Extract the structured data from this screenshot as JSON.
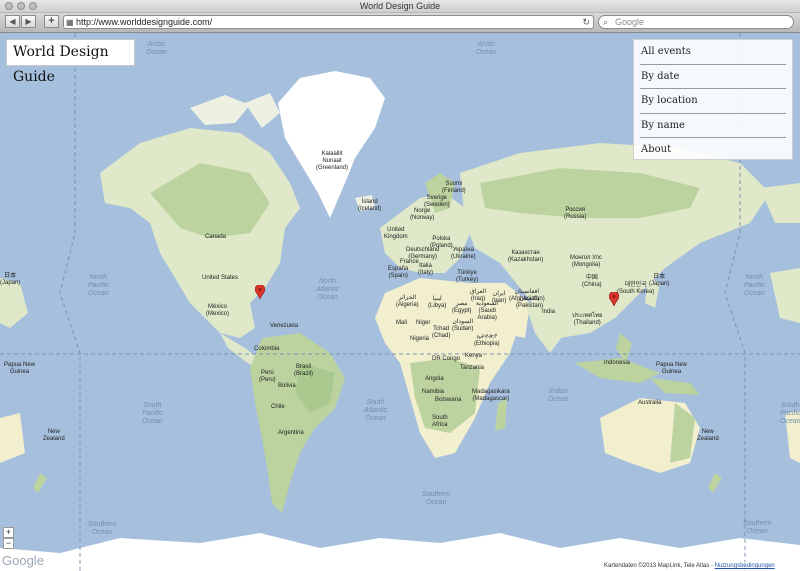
{
  "window": {
    "title": "World Design Guide"
  },
  "toolbar": {
    "back_icon": "chevron-left-icon",
    "forward_icon": "chevron-right-icon",
    "add_label": "+",
    "url": "http://www.worlddesignguide.com/",
    "search_placeholder": "Google"
  },
  "site": {
    "title": "World Design Guide"
  },
  "menu": {
    "items": [
      {
        "label": "All events"
      },
      {
        "label": "By date"
      },
      {
        "label": "By location"
      },
      {
        "label": "By name"
      },
      {
        "label": "About"
      }
    ]
  },
  "map": {
    "zoom_in": "+",
    "zoom_out": "−",
    "logo": "Google",
    "attribution": "Kartendaten ©2013 MapLink, Tele Atlas - ",
    "terms_link": "Nutzungsbedingungen",
    "oceans": {
      "arctic_left": "Arctic\nOcean",
      "arctic_right": "Arctic\nOcean",
      "north_pacific_left": "North\nPacific\nOcean",
      "north_atlantic": "North\nAtlantic\nOcean",
      "north_pacific_right": "North\nPacific\nOcean",
      "south_pacific_left": "South\nPacific\nOcean",
      "south_atlantic": "South\nAtlantic\nOcean",
      "indian": "Indian\nOcean",
      "south_pacific_right": "South\nPacific\nOcean",
      "southern_left": "Southern\nOcean",
      "southern_mid": "Southern\nOcean",
      "southern_right": "Southern\nOcean"
    },
    "labels": {
      "greenland": "Kalaallit\nNunaat\n(Greenland)",
      "iceland": "Ísland\n(Iceland)",
      "canada": "Canada",
      "united_states": "United States",
      "mexico": "México\n(Mexico)",
      "venezuela": "Venezuela",
      "colombia": "Colombia",
      "peru": "Perú\n(Peru)",
      "brazil": "Brasil\n(Brazil)",
      "bolivia": "Bolivia",
      "chile": "Chile",
      "argentina": "Argentina",
      "suomi": "Suomi\n(Finland)",
      "sverige": "Sverige\n(Sweden)",
      "norge": "Norge\n(Norway)",
      "uk": "United\nKingdom",
      "polska": "Polska\n(Poland)",
      "deutschland": "Deutschland\n(Germany)",
      "ukraine": "Україна\n(Ukraine)",
      "france": "France",
      "italia": "Italia\n(Italy)",
      "espana": "España\n(Spain)",
      "turkiye": "Türkiye\n(Turkey)",
      "russia": "Россия\n(Russia)",
      "kazakhstan": "Казахстан\n(Kazakhstan)",
      "mongolia": "Монгол Улс\n(Mongolia)",
      "china": "中国\n(China)",
      "japan": "日本\n(Japan)",
      "south_korea": "대한민국\n(South Korea)",
      "iran": "ایران\n(Iran)",
      "iraq": "العراق\n(Iraq)",
      "afghanistan": "افغانستان\n(Afghanistan)",
      "pakistan": "پاکستان\n(Pakistan)",
      "india": "India",
      "thailand": "ประเทศไทย\n(Thailand)",
      "algeria": "الجزائر\n(Algeria)",
      "libya": "ليبيا\n(Libya)",
      "egypt": "مصر\n(Egypt)",
      "saudi": "السعودية\n(Saudi\nArabia)",
      "mali": "Mali",
      "niger": "Niger",
      "tchad": "Tchad\n(Chad)",
      "sudan": "السودان\n(Sudan)",
      "ethiopia": "ኢትዮጵያ\n(Ethiopia)",
      "nigeria": "Nigeria",
      "dr_congo": "DR Congo",
      "kenya": "Kenya",
      "tanzania": "Tanzania",
      "angola": "Angola",
      "namibia": "Namibia",
      "botswana": "Botswana",
      "madagascar": "Madagasikara\n(Madagascar)",
      "south_africa": "South\nAfrica",
      "indonesia": "Indonesia",
      "png_right": "Papua New\nGuinea",
      "png_left": "Papua New\nGuinea",
      "australia": "Australia",
      "nz_right": "New\nZealand",
      "nz_left": "New\nZealand",
      "japan_left": "日本\n(Japan)"
    },
    "colors": {
      "water": "#a5bfdd",
      "land": "#dfe8c9",
      "forest": "#bcd3a0",
      "desert": "#f2efcf",
      "ice": "#ffffff",
      "pin": "#d9342b"
    }
  }
}
